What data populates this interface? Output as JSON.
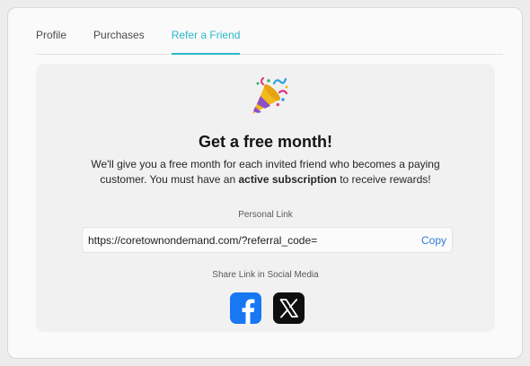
{
  "tabs": [
    {
      "label": "Profile"
    },
    {
      "label": "Purchases"
    },
    {
      "label": "Refer a Friend",
      "active": true
    }
  ],
  "referral": {
    "emoji_icon": "party-popper-icon",
    "title": "Get a free month!",
    "desc_part1": "We'll give you a free month for each invited friend who becomes a paying customer. You must have an ",
    "desc_bold": "active subscription",
    "desc_part2": " to receive rewards!",
    "personal_link_label": "Personal Link",
    "link_value": "https://coretownondemand.com/?referral_code=",
    "copy_label": "Copy",
    "share_label": "Share Link in Social Media",
    "social": [
      {
        "icon": "facebook-icon",
        "color": "#1877F2"
      },
      {
        "icon": "x-twitter-icon",
        "color": "#0F0F0F"
      }
    ]
  },
  "colors": {
    "accent": "#2BB8C9",
    "link": "#2F7DDC"
  }
}
